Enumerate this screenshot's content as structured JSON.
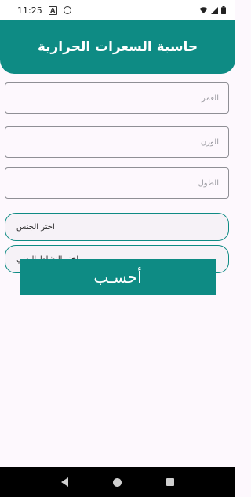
{
  "status_bar": {
    "time": "11:25",
    "left_icons": [
      "a-box-icon",
      "at-circle-icon"
    ],
    "right_icons": [
      "wifi-icon",
      "signal-icon",
      "battery-icon"
    ]
  },
  "header": {
    "title": "حاسبة السعرات الحرارية",
    "color": "#0e8b84"
  },
  "form": {
    "age_placeholder": "العمر",
    "weight_placeholder": "الوزن",
    "height_placeholder": "الطول",
    "gender_label": "اختر الجنس",
    "activity_label": "اختر النشاط البدني",
    "calculate_label": "أحسـب"
  },
  "nav_bar": {
    "icons": [
      "back-icon",
      "home-icon",
      "recents-icon"
    ]
  }
}
